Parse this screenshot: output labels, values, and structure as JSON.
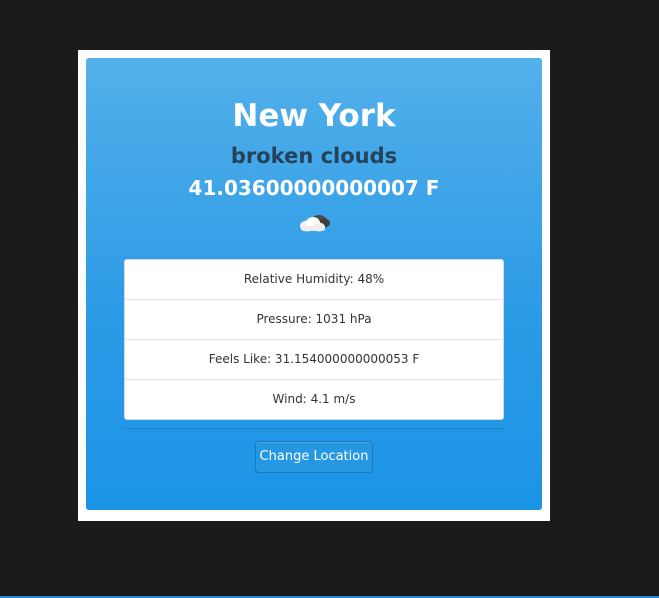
{
  "weather": {
    "city": "New York",
    "description": "broken clouds",
    "temperature": "41.03600000000007 F",
    "icon": "cloud-icon"
  },
  "details": [
    {
      "label": "Relative Humidity: 48%"
    },
    {
      "label": "Pressure: 1031 hPa"
    },
    {
      "label": "Feels Like: 31.154000000000053 F"
    },
    {
      "label": "Wind: 4.1 m/s"
    }
  ],
  "actions": {
    "change_location_label": "Change Location"
  },
  "colors": {
    "card_gradient_top": "#53b0ea",
    "card_gradient_bottom": "#1b94e6",
    "description_text": "#24425a",
    "page_background": "#1b1b1b"
  }
}
